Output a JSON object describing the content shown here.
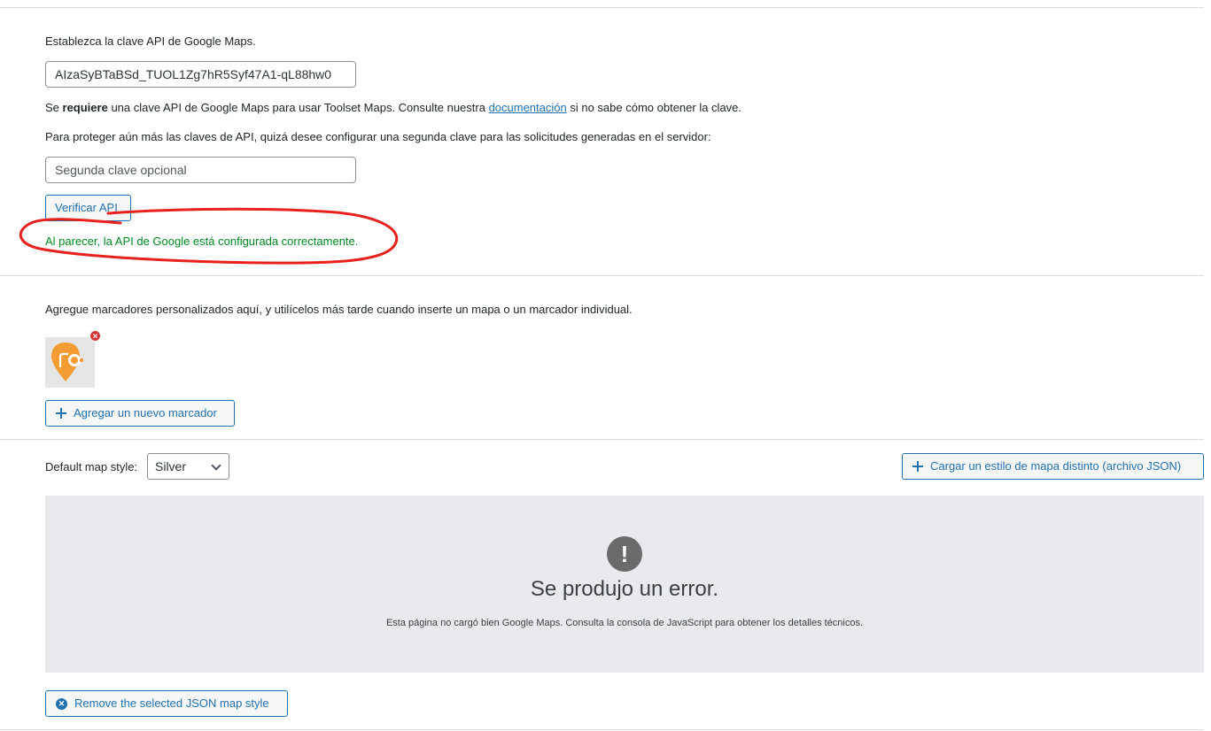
{
  "api_section": {
    "intro": "Establezca la clave API de Google Maps.",
    "api_key_value": "AIzaSyBTaBSd_TUOL1Zg7hR5Syf47A1-qL88hw0",
    "requires_prefix": "Se ",
    "requires_bold": "requiere",
    "requires_mid": " una clave API de Google Maps para usar Toolset Maps. Consulte nuestra ",
    "doc_link": "documentación",
    "requires_suffix": " si no sabe cómo obtener la clave.",
    "second_key_hint": "Para proteger aún más las claves de API, quizá desee configurar una segunda clave para las solicitudes generadas en el servidor:",
    "second_key_placeholder": "Segunda clave opcional",
    "verify_button": "Verificar API",
    "success_message": "Al parecer, la API de Google está configurada correctamente."
  },
  "markers_section": {
    "intro": "Agregue marcadores personalizados aquí, y utilícelos más tarde cuando inserte un mapa o un marcador individual.",
    "add_marker_button": "Agregar un nuevo marcador",
    "remove_badge": "×"
  },
  "style_section": {
    "default_style_label": "Default map style:",
    "default_style_value": "Silver",
    "upload_button": "Cargar un estilo de mapa distinto (archivo JSON)",
    "error_icon": "!",
    "error_title": "Se produjo un error.",
    "error_desc": "Esta página no cargó bien Google Maps. Consulta la consola de JavaScript para obtener los detalles técnicos.",
    "remove_style_button": "Remove the selected JSON map style"
  },
  "colors": {
    "accent": "#2271b1",
    "success": "#008a20",
    "annotation": "#e8211c",
    "marker": "#f39c33"
  }
}
